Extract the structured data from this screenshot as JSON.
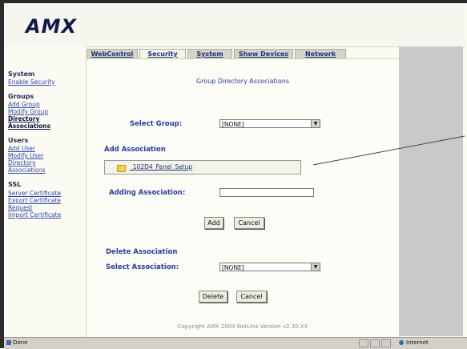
{
  "app": {
    "logo": "AMX"
  },
  "sidebar": {
    "sections": [
      {
        "title": "System",
        "links": [
          "Enable Security"
        ]
      },
      {
        "title": "Groups",
        "links": [
          "Add Group",
          "Modify Group",
          "Directory",
          "Associations"
        ]
      },
      {
        "title": "Users",
        "links": [
          "Add User",
          "Modify User",
          "Directory",
          "Associations"
        ]
      },
      {
        "title": "SSL",
        "links": [
          "Server Certificate",
          "Export Certificate",
          "Request",
          "Import Certificate"
        ]
      }
    ]
  },
  "tabs": [
    "WebControl",
    "Security",
    "System",
    "Show Devices",
    "Network"
  ],
  "main": {
    "title": "Group Directory Associations",
    "select_group_label": "Select Group:",
    "select_group_value": "[NONE]",
    "add_association_heading": "Add Association",
    "association_item": "_102D4_Panel_Setup",
    "adding_association_label": "Adding Association:",
    "adding_association_value": "",
    "add_button": "Add",
    "cancel_button_1": "Cancel",
    "delete_association_heading": "Delete Association",
    "select_association_label": "Select Association:",
    "select_association_value": "[NONE]",
    "delete_button": "Delete",
    "cancel_button_2": "Cancel",
    "copyright": "Copyright AMX 2004   NetLinx Version v2.30.XX"
  },
  "statusbar": {
    "status": "Done",
    "zone": "Internet"
  },
  "colors": {
    "accent": "#2a3aa0",
    "logo": "#0e1a4a",
    "chrome": "#d4d0c8"
  },
  "icons": {
    "folder": "folder-icon",
    "page": "page-icon",
    "zone": "globe-icon"
  }
}
